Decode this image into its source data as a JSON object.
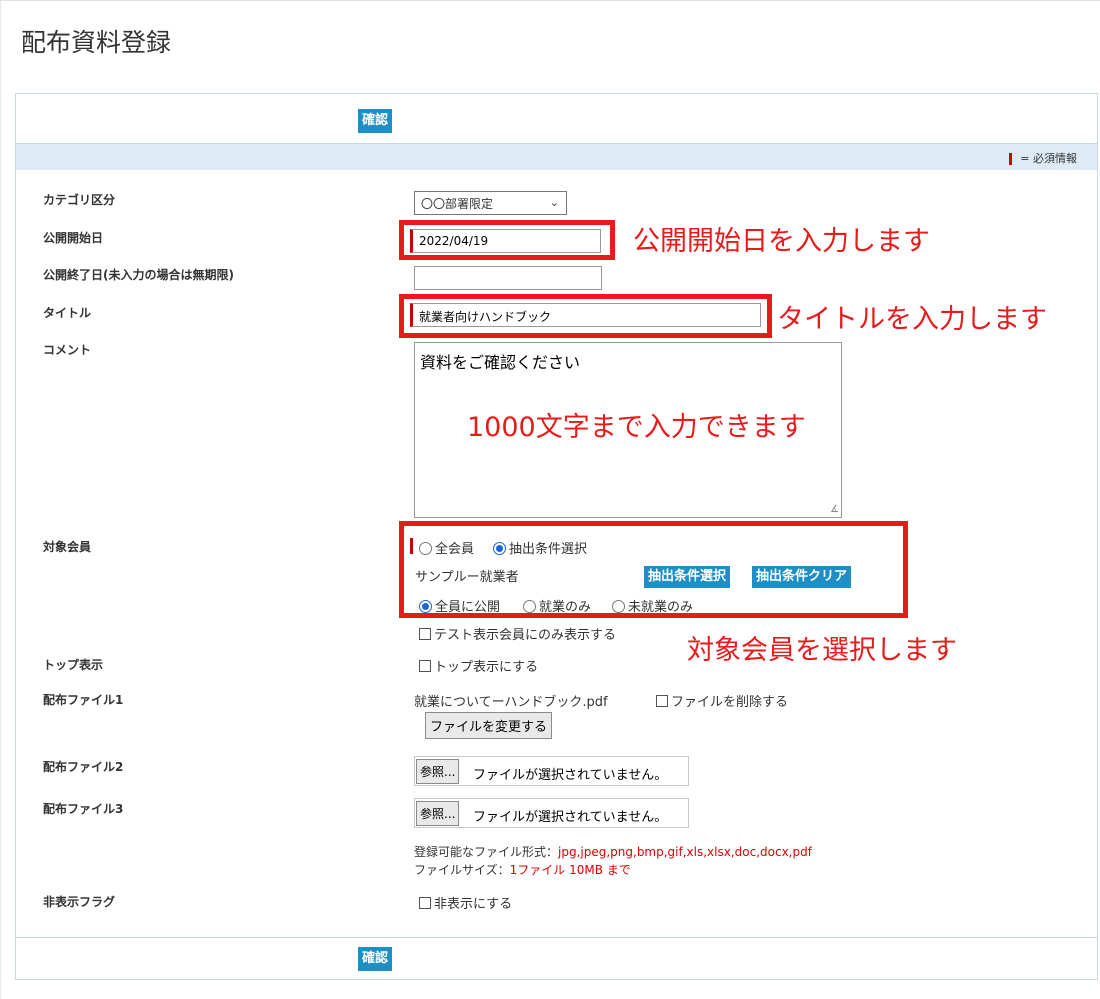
{
  "page_title": "配布資料登録",
  "confirm_label": "確認",
  "required_legend": "= 必須情報",
  "colors": {
    "accent": "#1e8fc6",
    "required": "#cc0000",
    "annotation": "#e81a1a",
    "header_band": "#deebf5"
  },
  "fields": {
    "category_label": "カテゴリ区分",
    "category_value": "〇〇部署限定",
    "start_label": "公開開始日",
    "start_value": "2022/04/19",
    "end_label": "公開終了日(未入力の場合は無期限)",
    "end_value": "",
    "title_label": "タイトル",
    "title_value": "就業者向けハンドブック",
    "comment_label": "コメント",
    "comment_value": "資料をご確認ください",
    "target_label": "対象会員",
    "target_all": "全会員",
    "target_filter": "抽出条件選択",
    "sample_text": "サンプルー就業者",
    "filter_select_btn": "抽出条件選択",
    "filter_clear_btn": "抽出条件クリア",
    "publish_all": "全員に公開",
    "publish_employed": "就業のみ",
    "publish_unemployed": "未就業のみ",
    "test_display": "テスト表示会員にのみ表示する",
    "top_label": "トップ表示",
    "top_option": "トップ表示にする",
    "file1_label": "配布ファイル1",
    "file1_name": "就業についてーハンドブック.pdf",
    "file1_delete": "ファイルを削除する",
    "file1_change": "ファイルを変更する",
    "file2_label": "配布ファイル2",
    "file3_label": "配布ファイル3",
    "browse_label": "参照...",
    "no_file_text": "ファイルが選択されていません。",
    "formats_prefix": "登録可能なファイル形式：",
    "formats_list": "jpg,jpeg,png,bmp,gif,xls,xlsx,doc,docx,pdf",
    "size_prefix": "ファイルサイズ：",
    "size_value": "1ファイル  10MB  まで",
    "hidden_label": "非表示フラグ",
    "hidden_option": "非表示にする"
  },
  "annotations": {
    "start_date": "公開開始日を入力します",
    "title": "タイトルを入力します",
    "comment": "1000文字まで入力できます",
    "target": "対象会員を選択します"
  }
}
